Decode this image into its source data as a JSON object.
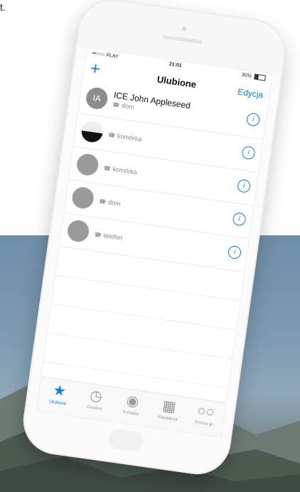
{
  "corner_text": "t.",
  "status_bar": {
    "carrier": "••○○○ PLAY",
    "time": "21:01",
    "battery": "35%"
  },
  "nav": {
    "add_icon": "plus-icon",
    "title": "Ulubione",
    "edit_label": "Edycja"
  },
  "favorites": [
    {
      "name": "ICE John Appleseed",
      "type": "dom",
      "avatar": "IA"
    },
    {
      "name": "",
      "type": "komórka",
      "avatar": ""
    },
    {
      "name": "",
      "type": "komórka",
      "avatar": ""
    },
    {
      "name": "",
      "type": "dom",
      "avatar": ""
    },
    {
      "name": "",
      "type": "telefon",
      "avatar": ""
    }
  ],
  "tabs": [
    {
      "label": "Ulubione",
      "icon": "star-icon"
    },
    {
      "label": "Ostatnie",
      "icon": "clock-icon"
    },
    {
      "label": "Kontakty",
      "icon": "contacts-icon"
    },
    {
      "label": "Klawiatura",
      "icon": "keypad-icon"
    },
    {
      "label": "Poczta gł.",
      "icon": "voicemail-icon"
    }
  ],
  "colors": {
    "accent": "#0a7cff",
    "inactive": "#9b9b9b"
  }
}
